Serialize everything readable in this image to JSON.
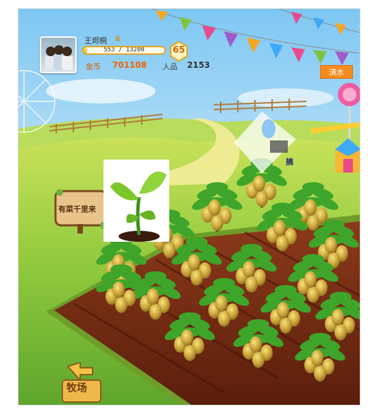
{
  "player": {
    "name": "王烬桐",
    "vip_icon": "vip-crown-icon"
  },
  "experience": {
    "current": 553,
    "max": 13200,
    "text": "553 / 13200"
  },
  "level": "65",
  "coins": {
    "label": "金币",
    "value": "701108"
  },
  "character": {
    "label": "人品",
    "value": "2153"
  },
  "actions": {
    "water": "浇水",
    "pick": "摘",
    "ranch": "牧场"
  },
  "sign": {
    "text": "有菜千里来"
  },
  "colors": {
    "accent": "#f58b1f",
    "soil": "#7a2a12",
    "grass": "#8cc63f"
  }
}
